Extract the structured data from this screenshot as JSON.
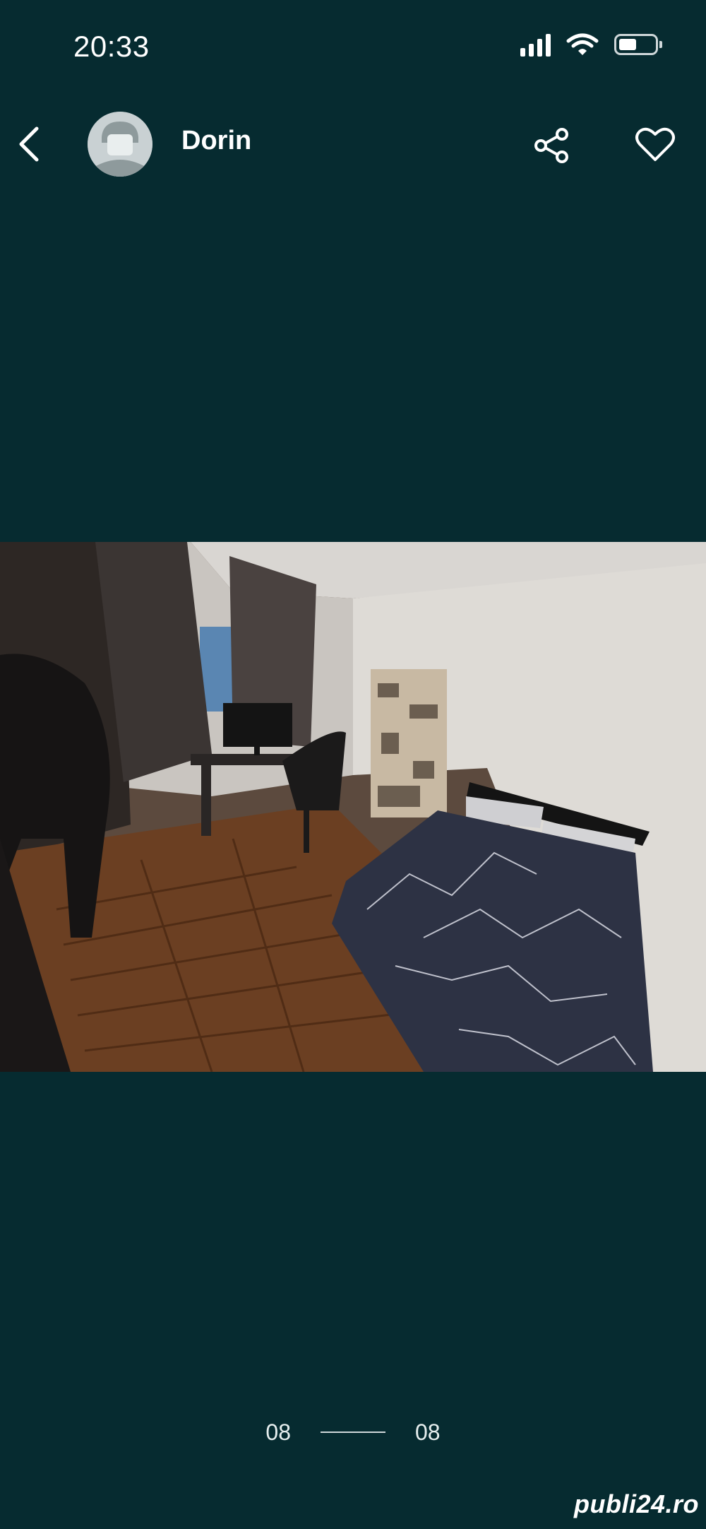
{
  "status_bar": {
    "time": "20:33",
    "battery_level": 0.45
  },
  "header": {
    "seller_name": "Dorin"
  },
  "gallery": {
    "current": "08",
    "total": "08"
  },
  "photo": {
    "description_icon": "bedroom-photo"
  },
  "watermark": "publi24.ro",
  "colors": {
    "background": "#062b30",
    "foreground": "#ffffff"
  }
}
